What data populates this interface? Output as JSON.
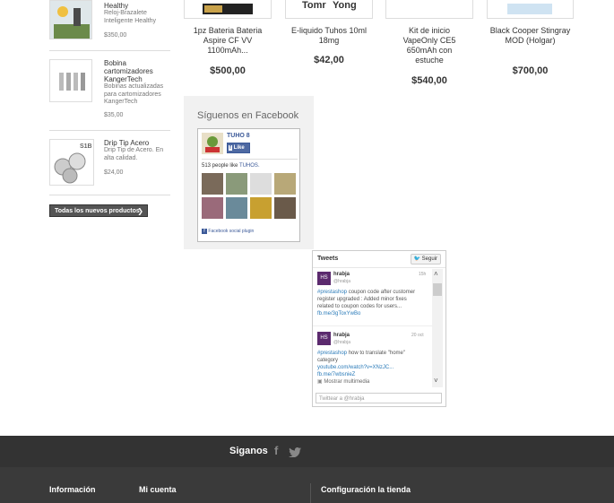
{
  "sidebar": {
    "items": [
      {
        "name": "Healthy",
        "desc": "Reloj-Brazalete Inteligente Healthy",
        "price": "$350,00"
      },
      {
        "name": "Bobina cartomizadores KangerTech",
        "desc": "Bobinas actualizadas para cartomizadores KangerTech",
        "price": "$35,00"
      },
      {
        "name": "Drip Tip Acero",
        "desc": "Drip Tip de Acero. En alta calidad.",
        "price": "$24,00"
      }
    ],
    "all_new_label": "Todas los nuevos productos",
    "thumb3_label": "S1B"
  },
  "products": [
    {
      "name": "1pz Bateria Bateria Aspire CF VV 1100mAh...",
      "price": "$500,00"
    },
    {
      "name": "E-liquido Tuhos 10ml 18mg",
      "price": "$42,00"
    },
    {
      "name": "Kit de inicio VapeOnly CE5 650mAh con estuche",
      "price": "$540,00"
    },
    {
      "name": "Black Cooper Stingray MOD (Holgar)",
      "price": "$700,00"
    }
  ],
  "product_img_labels": [
    "Tomr",
    "Yong"
  ],
  "facebook": {
    "title": "Síguenos en Facebook",
    "page_name": "TUHO 8",
    "like_label": "Like",
    "people_like": "513 people like",
    "people_like_page": "TUHOS.",
    "plugin_label": "Facebook social plugin"
  },
  "twitter": {
    "title": "Tweets",
    "follow_label": "Seguir",
    "tweets": [
      {
        "user": "hrabja",
        "handle": "@hrabja",
        "time": "15h",
        "hashtag": "#prestashop",
        "text": "coupon code after customer register upgraded : Added minor fixes related to coupon codes for users...",
        "link": "fb.me/3gToxYwBo"
      },
      {
        "user": "hrabja",
        "handle": "@hrabja",
        "time": "20 oct",
        "hashtag": "#prestashop",
        "text": "how to translate \"home\" category",
        "link": "youtube.com/watch?v=XNzJC...",
        "link2": "fb.me/7wbsnieZ",
        "media": "Mostrar multimedia"
      }
    ],
    "avatar_label": "HS",
    "input_placeholder": "Twittear a @hrabja"
  },
  "footer": {
    "follow_label": "Siganos",
    "columns": [
      "Información",
      "Mi cuenta",
      "Configuración la tienda"
    ]
  },
  "colors": {
    "footer_dark": "#333333",
    "twitter_link": "#2b7bb9",
    "facebook_blue": "#3b5998"
  }
}
